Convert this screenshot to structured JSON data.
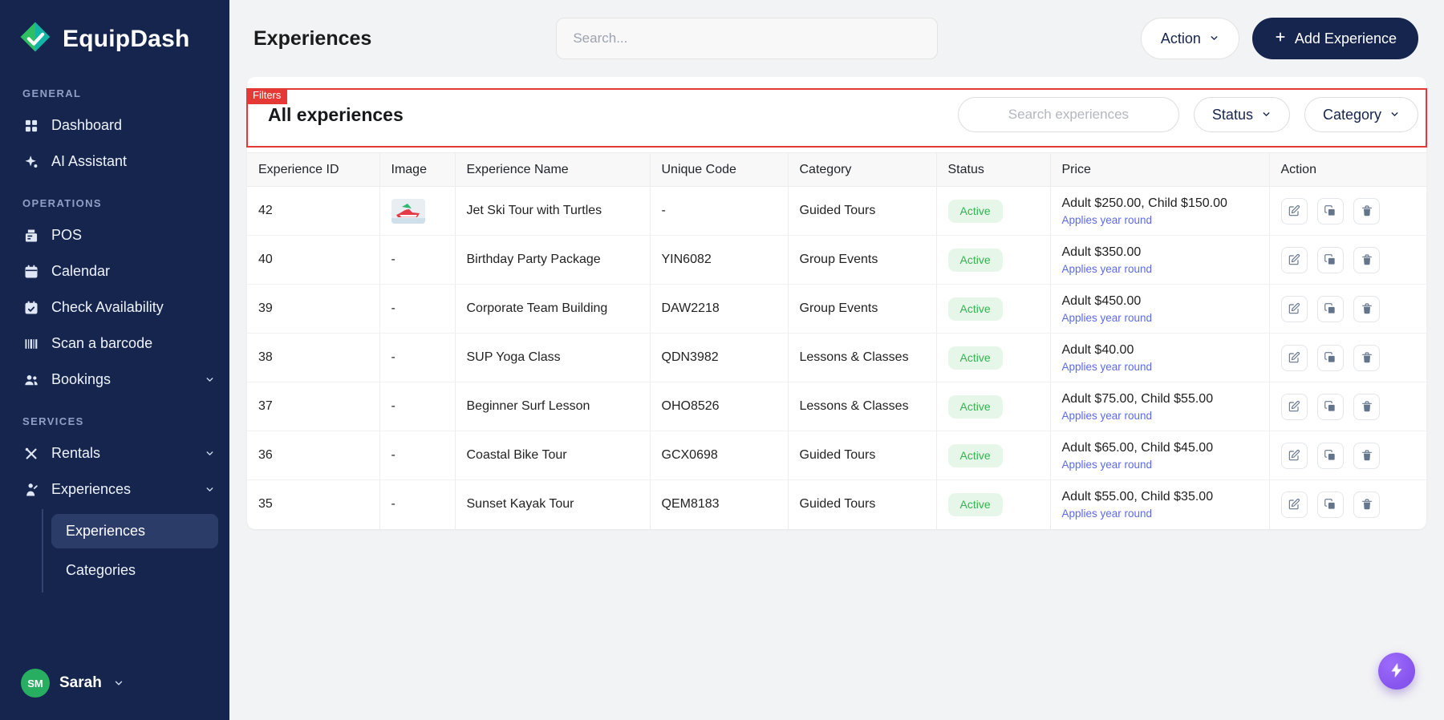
{
  "brand": {
    "name": "EquipDash"
  },
  "sidebar": {
    "section_general": "GENERAL",
    "section_operations": "OPERATIONS",
    "section_services": "SERVICES",
    "items": {
      "dashboard": "Dashboard",
      "ai_assistant": "AI Assistant",
      "pos": "POS",
      "calendar": "Calendar",
      "check_availability": "Check Availability",
      "scan_barcode": "Scan a barcode",
      "bookings": "Bookings",
      "rentals": "Rentals",
      "experiences": "Experiences",
      "experiences_sub": "Experiences",
      "categories_sub": "Categories"
    },
    "user": {
      "initials": "SM",
      "name": "Sarah"
    }
  },
  "header": {
    "title": "Experiences",
    "search_placeholder": "Search...",
    "action_label": "Action",
    "add_label": "Add Experience"
  },
  "filters": {
    "annotation_label": "Filters",
    "title": "All experiences",
    "search_placeholder": "Search experiences",
    "status_label": "Status",
    "category_label": "Category"
  },
  "table": {
    "columns": [
      "Experience ID",
      "Image",
      "Experience Name",
      "Unique Code",
      "Category",
      "Status",
      "Price",
      "Action"
    ],
    "rows": [
      {
        "id": "42",
        "image": "jet-ski-thumbnail",
        "name": "Jet Ski Tour with Turtles",
        "code": "-",
        "category": "Guided Tours",
        "status": "Active",
        "price": "Adult $250.00, Child $150.00",
        "price_note": "Applies year round"
      },
      {
        "id": "40",
        "image": "-",
        "name": "Birthday Party Package",
        "code": "YIN6082",
        "category": "Group Events",
        "status": "Active",
        "price": "Adult $350.00",
        "price_note": "Applies year round"
      },
      {
        "id": "39",
        "image": "-",
        "name": "Corporate Team Building",
        "code": "DAW2218",
        "category": "Group Events",
        "status": "Active",
        "price": "Adult $450.00",
        "price_note": "Applies year round"
      },
      {
        "id": "38",
        "image": "-",
        "name": "SUP Yoga Class",
        "code": "QDN3982",
        "category": "Lessons & Classes",
        "status": "Active",
        "price": "Adult $40.00",
        "price_note": "Applies year round"
      },
      {
        "id": "37",
        "image": "-",
        "name": "Beginner Surf Lesson",
        "code": "OHO8526",
        "category": "Lessons & Classes",
        "status": "Active",
        "price": "Adult $75.00, Child $55.00",
        "price_note": "Applies year round"
      },
      {
        "id": "36",
        "image": "-",
        "name": "Coastal Bike Tour",
        "code": "GCX0698",
        "category": "Guided Tours",
        "status": "Active",
        "price": "Adult $65.00, Child $45.00",
        "price_note": "Applies year round"
      },
      {
        "id": "35",
        "image": "-",
        "name": "Sunset Kayak Tour",
        "code": "QEM8183",
        "category": "Guided Tours",
        "status": "Active",
        "price": "Adult $55.00, Child $35.00",
        "price_note": "Applies year round"
      }
    ]
  },
  "colors": {
    "sidebar_bg": "#16254d",
    "accent_navy": "#16254d",
    "active_badge_bg": "#e6f7ea",
    "active_badge_text": "#34b24f",
    "price_note_blue": "#5b6af0",
    "annotation_red": "#e53935",
    "assistant_purple": "#8b5cf6",
    "avatar_green": "#27ae60",
    "logo_teal": "#10b5a5",
    "logo_green": "#2fbf63"
  }
}
